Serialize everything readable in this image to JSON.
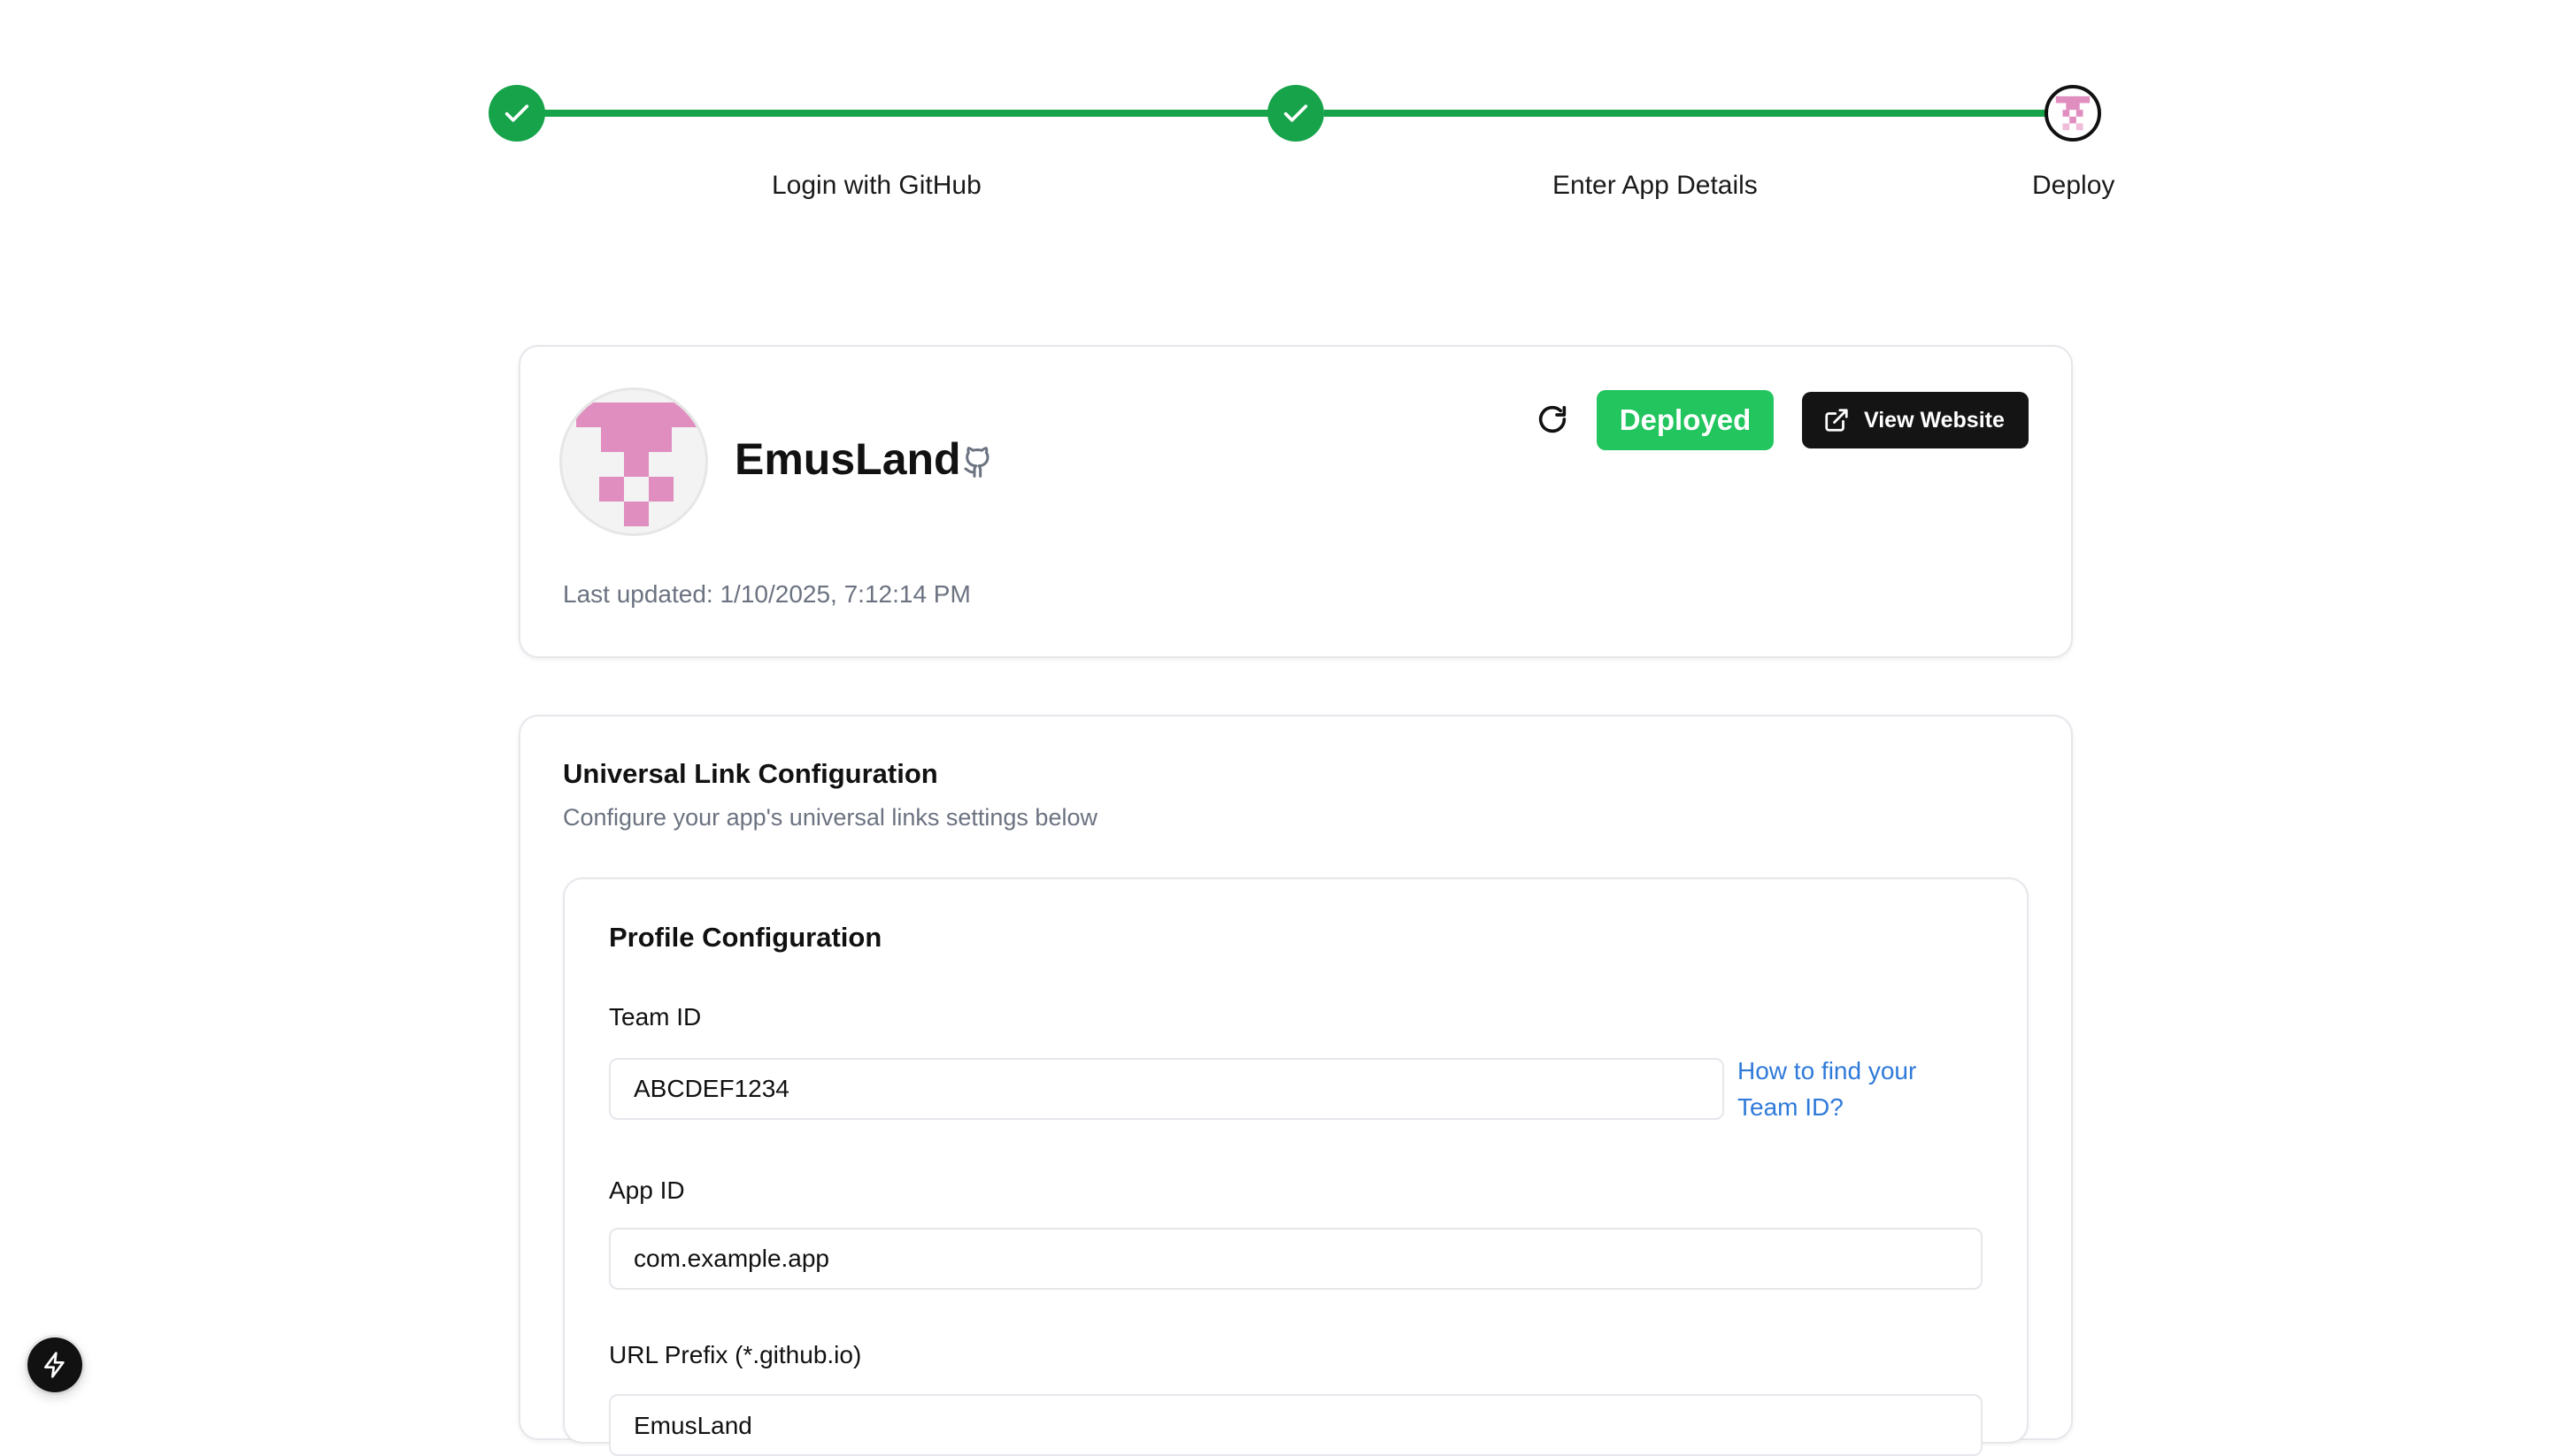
{
  "stepper": {
    "steps": [
      {
        "label": "Login with GitHub",
        "status": "complete"
      },
      {
        "label": "Enter App Details",
        "status": "complete"
      },
      {
        "label": "Deploy",
        "status": "current"
      }
    ],
    "complete_color": "#16a34a"
  },
  "project": {
    "name": "EmusLand",
    "last_updated": "Last updated: 1/10/2025, 7:12:14 PM",
    "status_label": "Deployed",
    "view_website_label": "View Website",
    "icons": [
      "refresh-icon",
      "github-icon",
      "external-link-icon"
    ],
    "avatar_color": "#e08ec0",
    "status_color": "#22c55e"
  },
  "universal_link": {
    "title": "Universal Link Configuration",
    "subtitle": "Configure your app's universal links settings below",
    "profile": {
      "title": "Profile Configuration",
      "team_id_label": "Team ID",
      "team_id_value": "ABCDEF1234",
      "team_id_help": "How to find your Team ID?",
      "app_id_label": "App ID",
      "app_id_value": "com.example.app",
      "url_prefix_label": "URL Prefix (*.github.io)",
      "url_prefix_value": "EmusLand"
    }
  },
  "floating": {
    "icon": "bolt-icon"
  },
  "link_color": "#2f7ad9"
}
